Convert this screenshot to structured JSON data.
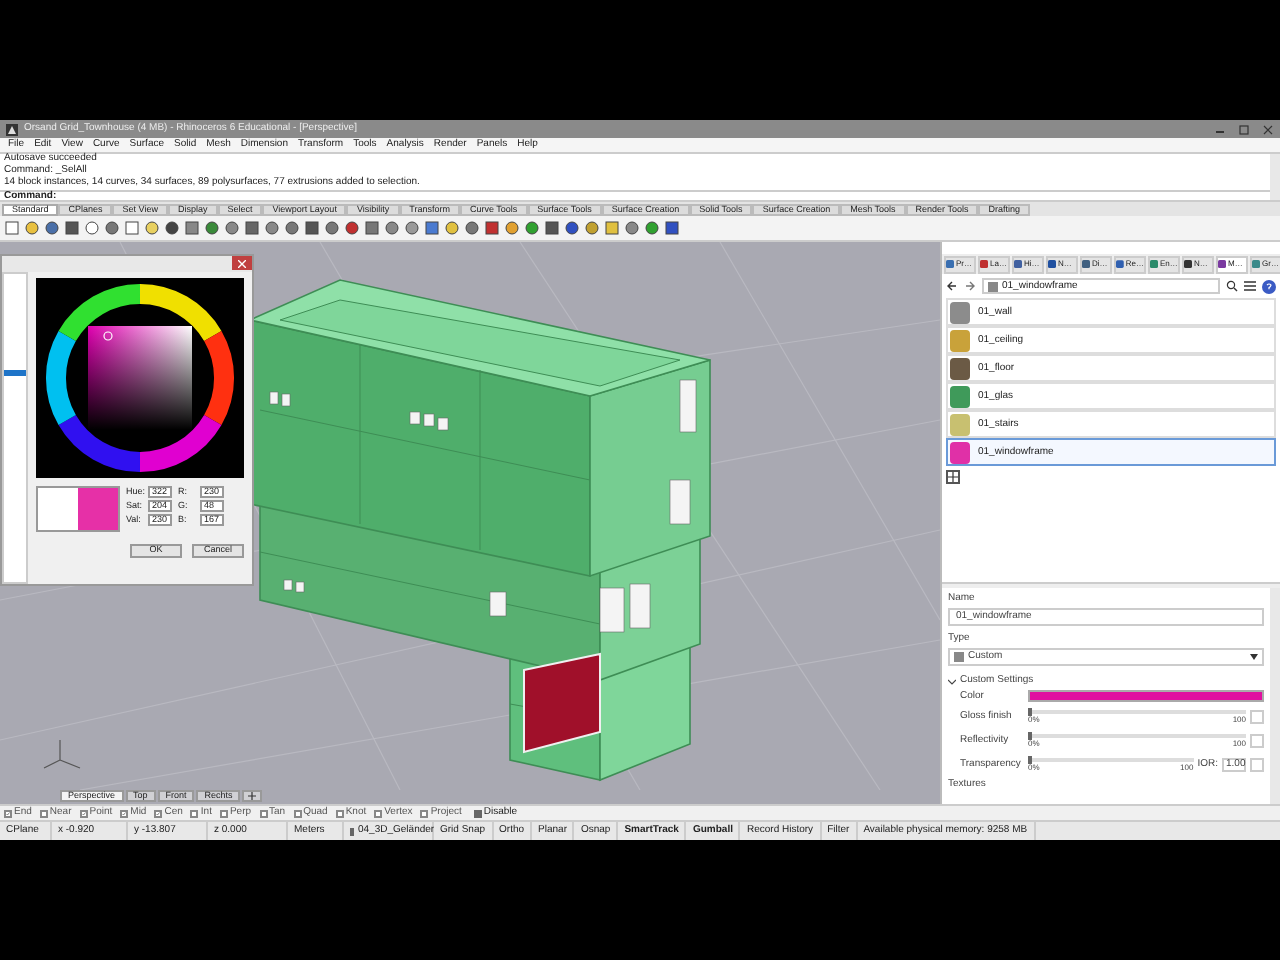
{
  "window": {
    "title": "Orsand Grid_Townhouse (4 MB) - Rhinoceros 6 Educational - [Perspective]"
  },
  "menu": [
    "File",
    "Edit",
    "View",
    "Curve",
    "Surface",
    "Solid",
    "Mesh",
    "Dimension",
    "Transform",
    "Tools",
    "Analysis",
    "Render",
    "Panels",
    "Help"
  ],
  "command_history": [
    "Autosave succeeded",
    "Command: _SelAll",
    "14 block instances, 14 curves, 34 surfaces, 89 polysurfaces, 77 extrusions added to selection."
  ],
  "command_prompt": "Command:",
  "toolbar_tabs": [
    {
      "label": "Standard",
      "selected": true
    },
    {
      "label": "CPlanes",
      "selected": false
    },
    {
      "label": "Set View",
      "selected": false
    },
    {
      "label": "Display",
      "selected": false
    },
    {
      "label": "Select",
      "selected": false
    },
    {
      "label": "Viewport Layout",
      "selected": false
    },
    {
      "label": "Visibility",
      "selected": false
    },
    {
      "label": "Transform",
      "selected": false
    },
    {
      "label": "Curve Tools",
      "selected": false
    },
    {
      "label": "Surface Tools",
      "selected": false
    },
    {
      "label": "Surface Creation",
      "selected": false
    },
    {
      "label": "Solid Tools",
      "selected": false
    },
    {
      "label": "Surface Creation",
      "selected": false
    },
    {
      "label": "Mesh Tools",
      "selected": false
    },
    {
      "label": "Render Tools",
      "selected": false
    },
    {
      "label": "Drafting",
      "selected": false
    }
  ],
  "color_dialog": {
    "hsv": [
      {
        "label": "Hue:",
        "value": "322"
      },
      {
        "label": "Sat:",
        "value": "204"
      },
      {
        "label": "Val:",
        "value": "230"
      }
    ],
    "rgb": [
      {
        "label": "R:",
        "value": "230"
      },
      {
        "label": "G:",
        "value": "48"
      },
      {
        "label": "B:",
        "value": "167"
      }
    ],
    "buttons": [
      "OK",
      "Cancel"
    ]
  },
  "panel_tabs": [
    {
      "label": "Pr…",
      "selected": false
    },
    {
      "label": "La…",
      "selected": false
    },
    {
      "label": "Hi…",
      "selected": false
    },
    {
      "label": "N…",
      "selected": false
    },
    {
      "label": "Di…",
      "selected": false
    },
    {
      "label": "Re…",
      "selected": false
    },
    {
      "label": "En…",
      "selected": false
    },
    {
      "label": "N…",
      "selected": false
    },
    {
      "label": "M…",
      "selected": true
    },
    {
      "label": "Gr…",
      "selected": false
    }
  ],
  "materials": {
    "search": "01_windowframe",
    "items": [
      {
        "name": "01_wall",
        "selected": false,
        "color": "#8c8c8c"
      },
      {
        "name": "01_ceiling",
        "selected": false,
        "color": "#c9a23a"
      },
      {
        "name": "01_floor",
        "selected": false,
        "color": "#6b5a45"
      },
      {
        "name": "01_glas",
        "selected": false,
        "color": "#3f9a5a"
      },
      {
        "name": "01_stairs",
        "selected": false,
        "color": "#c8c070"
      },
      {
        "name": "01_windowframe",
        "selected": true,
        "color": "#e030a7"
      }
    ]
  },
  "properties": {
    "name_label": "Name",
    "name": "01_windowframe",
    "type_label": "Type",
    "type": "Custom",
    "section": "Custom Settings",
    "expanded": true,
    "color_label": "Color",
    "sliders": [
      {
        "label": "Gloss finish",
        "level": 0,
        "min": "0%",
        "max": "100"
      },
      {
        "label": "Reflectivity",
        "level": 0,
        "min": "0%",
        "max": "100"
      },
      {
        "label": "Transparency",
        "level": 0,
        "min": "0%",
        "max": "100"
      }
    ],
    "ior_label": "IOR:",
    "ior": "1.00",
    "next_section": "Textures"
  },
  "viewport_tabs": [
    {
      "label": "Perspective",
      "selected": true
    },
    {
      "label": "Top",
      "selected": false
    },
    {
      "label": "Front",
      "selected": false
    },
    {
      "label": "Rechts",
      "selected": false
    }
  ],
  "osnaps": [
    {
      "label": "End",
      "checked": true
    },
    {
      "label": "Near",
      "checked": false
    },
    {
      "label": "Point",
      "checked": true
    },
    {
      "label": "Mid",
      "checked": true
    },
    {
      "label": "Cen",
      "checked": true
    },
    {
      "label": "Int",
      "checked": false
    },
    {
      "label": "Perp",
      "checked": false
    },
    {
      "label": "Tan",
      "checked": false
    },
    {
      "label": "Quad",
      "checked": false
    },
    {
      "label": "Knot",
      "checked": false
    },
    {
      "label": "Vertex",
      "checked": false
    },
    {
      "label": "Project",
      "checked": false
    }
  ],
  "osnap_disable": {
    "label": "Disable",
    "checked": true
  },
  "status_bar": [
    {
      "kind": "text",
      "text": "CPlane"
    },
    {
      "kind": "text",
      "text": "x -0.920"
    },
    {
      "kind": "text",
      "text": "y -13.807"
    },
    {
      "kind": "text",
      "text": "z 0.000"
    },
    {
      "kind": "text",
      "text": "Meters"
    },
    {
      "kind": "layer",
      "text": "04_3D_Geländer"
    },
    {
      "kind": "toggle",
      "text": "Grid Snap",
      "on": false
    },
    {
      "kind": "toggle",
      "text": "Ortho",
      "on": false
    },
    {
      "kind": "toggle",
      "text": "Planar",
      "on": false
    },
    {
      "kind": "toggle",
      "text": "Osnap",
      "on": false
    },
    {
      "kind": "toggle",
      "text": "SmartTrack",
      "on": true
    },
    {
      "kind": "toggle",
      "text": "Gumball",
      "on": true
    },
    {
      "kind": "toggle",
      "text": "Record History",
      "on": false
    },
    {
      "kind": "toggle",
      "text": "Filter",
      "on": false
    },
    {
      "kind": "text",
      "text": "Available physical memory: 9258 MB"
    }
  ]
}
